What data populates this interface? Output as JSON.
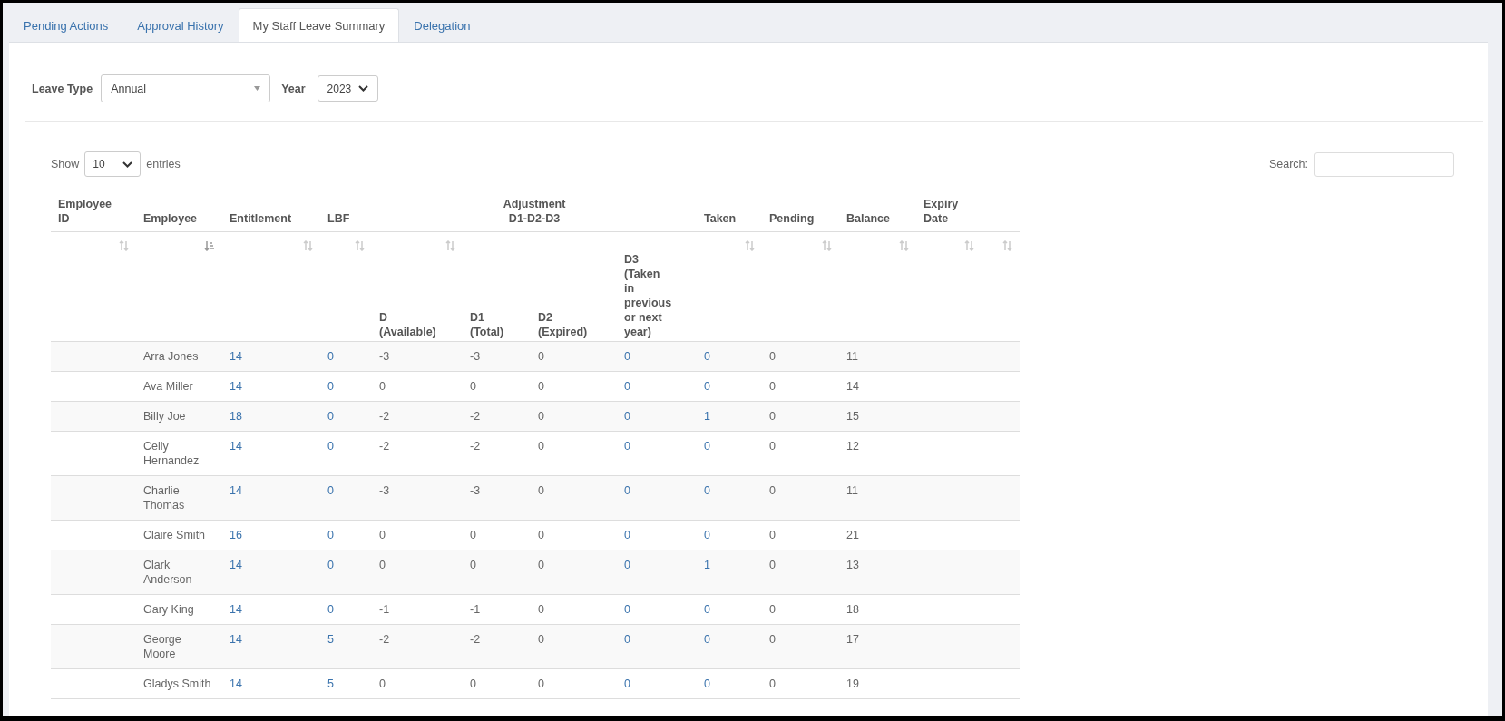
{
  "tabs": [
    {
      "label": "Pending Actions",
      "selected": false
    },
    {
      "label": "Approval History",
      "selected": false
    },
    {
      "label": "My Staff Leave Summary",
      "selected": true
    },
    {
      "label": "Delegation",
      "selected": false
    }
  ],
  "filters": {
    "leave_type": {
      "label": "Leave Type",
      "value": "Annual"
    },
    "year": {
      "label": "Year",
      "value": "2023"
    }
  },
  "length_menu": {
    "label_before": "Show",
    "value": "10",
    "label_after": "entries"
  },
  "search": {
    "label": "Search:"
  },
  "table": {
    "header_top": [
      {
        "kind": "column",
        "label": "Employee\nID"
      },
      {
        "kind": "column",
        "label": "Employee"
      },
      {
        "kind": "column",
        "label": "Entitlement"
      },
      {
        "kind": "column",
        "label": "LBF"
      },
      {
        "kind": "group",
        "label": "Adjustment\nD1-D2-D3"
      },
      {
        "kind": "column",
        "label": "Taken"
      },
      {
        "kind": "column",
        "label": "Pending"
      },
      {
        "kind": "column",
        "label": "Balance"
      },
      {
        "kind": "column",
        "label": "Expiry\nDate"
      }
    ],
    "header_sub": [
      {
        "sortable": true,
        "sorted": false
      },
      {
        "sortable": true,
        "sorted": true
      },
      {
        "sortable": true,
        "sorted": false
      },
      {
        "sortable": true,
        "sorted": false
      },
      {
        "label": "D\n(Available)",
        "sortable": true,
        "sorted": false
      },
      {
        "label": "D1\n(Total)",
        "sortable": false
      },
      {
        "label": "D2\n(Expired)",
        "sortable": false
      },
      {
        "label": "D3\n(Taken\nin\nprevious\nor next\nyear)",
        "sortable": false
      },
      {
        "sortable": true,
        "sorted": false
      },
      {
        "sortable": true,
        "sorted": false
      },
      {
        "sortable": true,
        "sorted": false
      },
      {
        "sortable": true,
        "sorted": false
      },
      {
        "sortable": true,
        "sorted": false
      }
    ],
    "value_columns": [
      {
        "kind": "link"
      },
      {
        "kind": "link"
      },
      {
        "kind": "text"
      },
      {
        "kind": "text"
      },
      {
        "kind": "text"
      },
      {
        "kind": "link"
      },
      {
        "kind": "link"
      },
      {
        "kind": "text"
      },
      {
        "kind": "text"
      }
    ],
    "rows": [
      {
        "employee": "Arra Jones",
        "values": [
          "14",
          "0",
          "-3",
          "-3",
          "0",
          "0",
          "0",
          "0",
          "11"
        ]
      },
      {
        "employee": "Ava Miller",
        "values": [
          "14",
          "0",
          "0",
          "0",
          "0",
          "0",
          "0",
          "0",
          "14"
        ]
      },
      {
        "employee": "Billy Joe",
        "values": [
          "18",
          "0",
          "-2",
          "-2",
          "0",
          "0",
          "1",
          "0",
          "15"
        ]
      },
      {
        "employee": "Celly\nHernandez",
        "values": [
          "14",
          "0",
          "-2",
          "-2",
          "0",
          "0",
          "0",
          "0",
          "12"
        ]
      },
      {
        "employee": "Charlie\nThomas",
        "values": [
          "14",
          "0",
          "-3",
          "-3",
          "0",
          "0",
          "0",
          "0",
          "11"
        ]
      },
      {
        "employee": "Claire Smith",
        "values": [
          "16",
          "0",
          "0",
          "0",
          "0",
          "0",
          "0",
          "0",
          "21"
        ]
      },
      {
        "employee": "Clark\nAnderson",
        "values": [
          "14",
          "0",
          "0",
          "0",
          "0",
          "0",
          "1",
          "0",
          "13"
        ]
      },
      {
        "employee": "Gary King",
        "values": [
          "14",
          "0",
          "-1",
          "-1",
          "0",
          "0",
          "0",
          "0",
          "18"
        ]
      },
      {
        "employee": "George\nMoore",
        "values": [
          "14",
          "5",
          "-2",
          "-2",
          "0",
          "0",
          "0",
          "0",
          "17"
        ]
      },
      {
        "employee": "Gladys Smith",
        "values": [
          "14",
          "5",
          "0",
          "0",
          "0",
          "0",
          "0",
          "0",
          "19"
        ]
      }
    ]
  }
}
